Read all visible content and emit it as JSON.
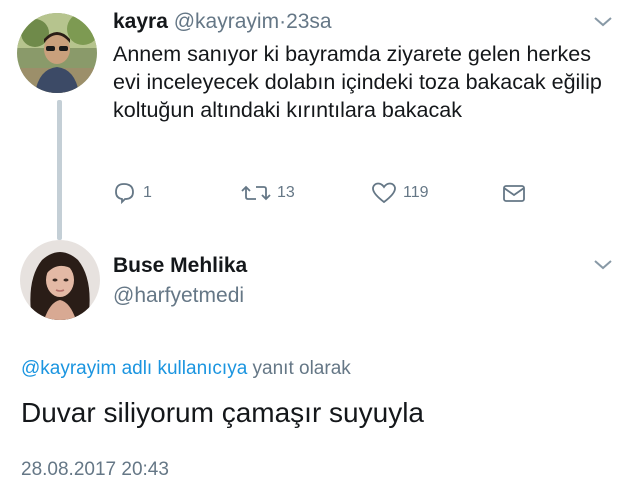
{
  "tweet1": {
    "author_name": "kayra",
    "author_handle": "@kayrayim",
    "separator": "·",
    "time": "23sa",
    "text": "Annem sanıyor ki bayramda ziyarete gelen herkes evi inceleyecek dolabın içindeki toza bakacak eğilip koltuğun altındaki kırıntılara bakacak",
    "actions": {
      "reply": {
        "icon": "reply-icon",
        "count": "1"
      },
      "retweet": {
        "icon": "retweet-icon",
        "count": "13"
      },
      "like": {
        "icon": "heart-icon",
        "count": "119"
      },
      "message": {
        "icon": "envelope-icon"
      }
    }
  },
  "tweet2": {
    "author_name": "Buse Mehlika",
    "author_handle": "@harfyetmedi",
    "replying_mention": "@kayrayim adlı kullanıcıya",
    "replying_suffix": "yanıt olarak",
    "text": "Duvar siliyorum çamaşır suyuyla",
    "timestamp": "28.08.2017 20:43"
  },
  "colors": {
    "text": "#14171a",
    "muted": "#657786",
    "link": "#1b95e0",
    "thread_line": "#c4cfd6"
  }
}
